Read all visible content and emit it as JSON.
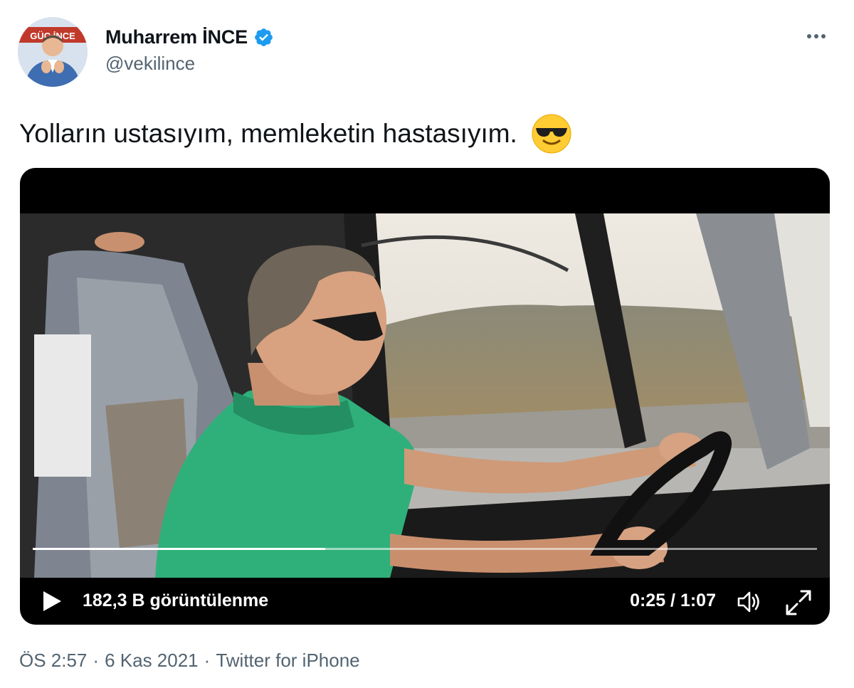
{
  "author": {
    "display_name": "Muharrem İNCE",
    "handle": "@vekilince",
    "verified_icon": "verified-badge-icon",
    "verified_color": "#1d9bf0",
    "avatar_sign_text": "GÜÇ İNCE"
  },
  "tweet": {
    "text": "Yolların ustasıyım, memleketin hastasıyım.",
    "emoji": "smiling-face-with-sunglasses-emoji"
  },
  "video": {
    "views": "182,3 B görüntülenme",
    "time": "0:25 / 1:07",
    "progress_fraction": 0.373,
    "play_icon": "play-icon",
    "volume_icon": "volume-icon",
    "fullscreen_icon": "fullscreen-icon"
  },
  "meta": {
    "time": "ÖS 2:57",
    "date": "6 Kas 2021",
    "separator": "·",
    "source": "Twitter for iPhone"
  },
  "colors": {
    "text_primary": "#0f1419",
    "text_secondary": "#536471",
    "verified_blue": "#1d9bf0"
  }
}
